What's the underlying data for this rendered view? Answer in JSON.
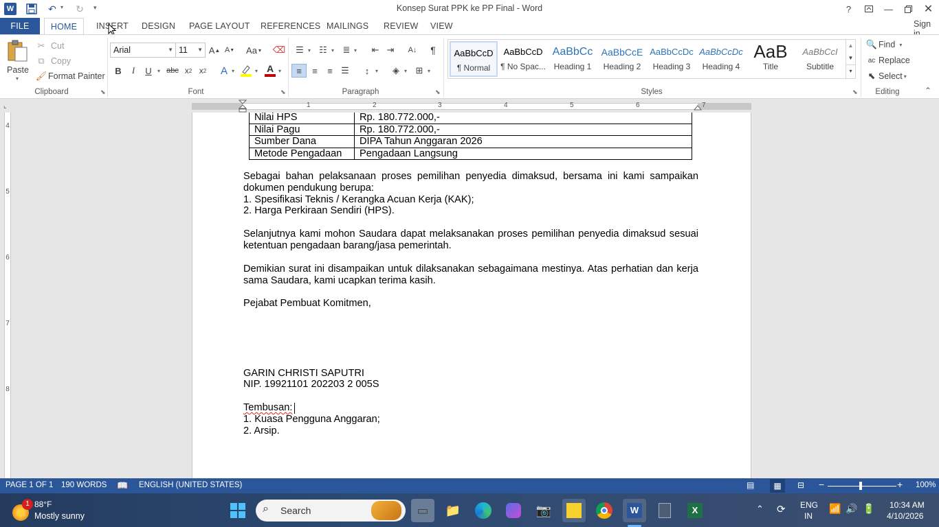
{
  "window": {
    "title": "Konsep Surat PPK ke PP Final - Word",
    "help": "?",
    "qat_more": "▾",
    "sign_in": "Sign in"
  },
  "tabs": [
    {
      "label": "FILE"
    },
    {
      "label": "HOME"
    },
    {
      "label": "INSERT"
    },
    {
      "label": "DESIGN"
    },
    {
      "label": "PAGE LAYOUT"
    },
    {
      "label": "REFERENCES"
    },
    {
      "label": "MAILINGS"
    },
    {
      "label": "REVIEW"
    },
    {
      "label": "VIEW"
    }
  ],
  "clipboard": {
    "paste": "Paste",
    "cut": "Cut",
    "copy": "Copy",
    "format_painter": "Format Painter",
    "label": "Clipboard"
  },
  "font": {
    "family": "Arial",
    "size": "11",
    "label": "Font"
  },
  "paragraph": {
    "label": "Paragraph"
  },
  "styles": {
    "label": "Styles",
    "items": [
      {
        "preview": "AaBbCcD",
        "name": "¶ Normal"
      },
      {
        "preview": "AaBbCcD",
        "name": "¶ No Spac..."
      },
      {
        "preview": "AaBbCc",
        "name": "Heading 1"
      },
      {
        "preview": "AaBbCcE",
        "name": "Heading 2"
      },
      {
        "preview": "AaBbCcDc",
        "name": "Heading 3"
      },
      {
        "preview": "AaBbCcDc",
        "name": "Heading 4"
      },
      {
        "preview": "AaB",
        "name": "Title"
      },
      {
        "preview": "AaBbCcI",
        "name": "Subtitle"
      }
    ]
  },
  "editing": {
    "find": "Find",
    "replace": "Replace",
    "select": "Select",
    "label": "Editing"
  },
  "ruler": {
    "h": [
      "1",
      "2",
      "3",
      "4",
      "5",
      "6",
      "7"
    ],
    "v": [
      "4",
      "5",
      "6",
      "7",
      "8"
    ]
  },
  "document": {
    "table": [
      [
        "Nilai HPS",
        "Rp. 180.772.000,-"
      ],
      [
        "Nilai Pagu",
        "Rp. 180.772.000,-"
      ],
      [
        "Sumber Dana",
        "DIPA Tahun Anggaran 2026"
      ],
      [
        "Metode Pengadaan",
        "Pengadaan Langsung"
      ]
    ],
    "para1_a": "Sebagai bahan pelaksanaan proses pemilihan penyedia dimaksud, bersama ini kami sampaikan",
    "para1_b": "dokumen pendukung berupa:",
    "item1": "1.  Spesifikasi Teknis / Kerangka Acuan Kerja (KAK);",
    "item2": "2.  Harga Perkiraan Sendiri (HPS).",
    "para2_a": "Selanjutnya kami mohon Saudara dapat melaksanakan proses pemilihan penyedia dimaksud sesuai",
    "para2_b": "ketentuan pengadaan barang/jasa pemerintah.",
    "para3_a": "Demikian surat ini disampaikan untuk dilaksanakan sebagaimana mestinya. Atas perhatian dan kerja",
    "para3_b": "sama Saudara, kami ucapkan terima kasih.",
    "closing": "Pejabat Pembuat Komitmen,",
    "signer": "GARIN CHRISTI SAPUTRI",
    "nip": "NIP.  19921101 202203 2 005S",
    "cc_title": "Tembusan:",
    "cc1": "1. Kuasa Pengguna Anggaran;",
    "cc2": "2. Arsip."
  },
  "status": {
    "page": "PAGE 1 OF 1",
    "words": "190 WORDS",
    "language": "ENGLISH (UNITED STATES)",
    "zoom": "100%",
    "zoom_minus": "−",
    "zoom_plus": "+"
  },
  "taskbar": {
    "weather_temp": "88°F",
    "weather_desc": "Mostly sunny",
    "weather_badge": "1",
    "search": "Search",
    "lang_top": "ENG",
    "lang_bottom": "IN",
    "time": "10:34 AM",
    "date": "4/10/2026"
  },
  "colors": {
    "accent": "#2b579a",
    "highlight": "#ffff00",
    "font_red": "#c00000"
  }
}
